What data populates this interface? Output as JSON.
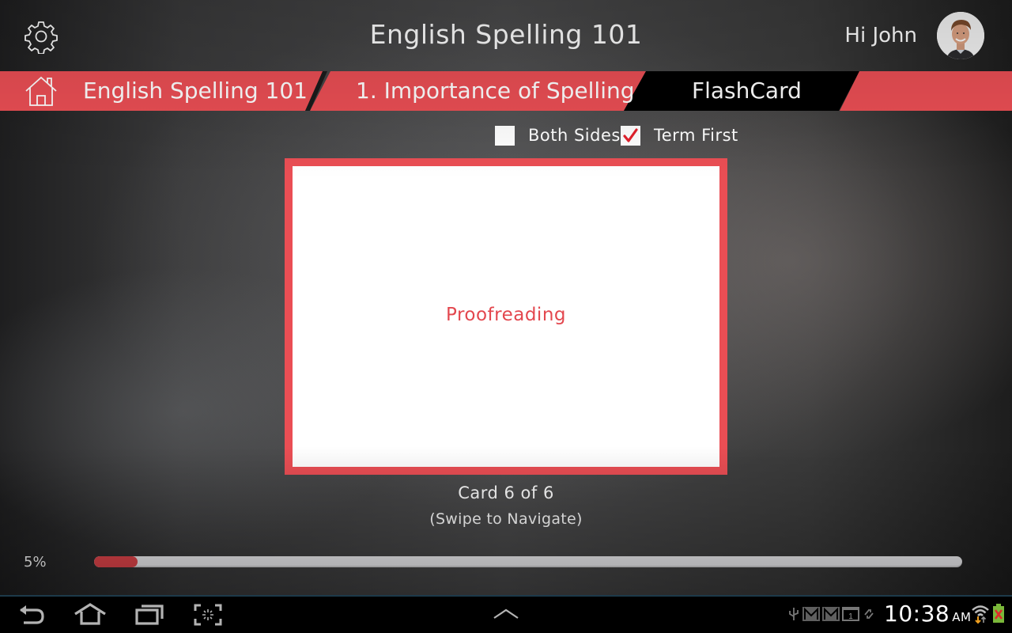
{
  "header": {
    "title": "English Spelling 101",
    "greeting": "Hi John",
    "settings_icon": "gear-icon",
    "avatar_icon": "user-avatar"
  },
  "breadcrumb": {
    "home_icon": "home-icon",
    "items": [
      {
        "label": "English Spelling 101"
      },
      {
        "label": "1. Importance of Spelling"
      },
      {
        "label": "FlashCard",
        "active": true
      }
    ]
  },
  "options": {
    "both_sides": {
      "label": "Both Sides",
      "checked": false
    },
    "term_first": {
      "label": "Term First",
      "checked": true
    }
  },
  "card": {
    "term": "Proofreading",
    "counter": "Card 6 of 6",
    "hint": "(Swipe to Navigate)"
  },
  "progress": {
    "label": "5%",
    "value_percent": 5
  },
  "system_bar": {
    "nav_icons": [
      "back-icon",
      "home-icon",
      "recent-apps-icon",
      "screenshot-icon",
      "chevron-up-icon"
    ],
    "status_icons": [
      "usb-icon",
      "gmail-icon",
      "gmail-icon",
      "calendar-icon",
      "sync-icon"
    ],
    "notification_count": "1",
    "time": "10:38",
    "ampm": "AM"
  },
  "colors": {
    "accent": "#ea4e54",
    "accent_text": "#e3474e",
    "active_crumb_bg": "#000000"
  }
}
